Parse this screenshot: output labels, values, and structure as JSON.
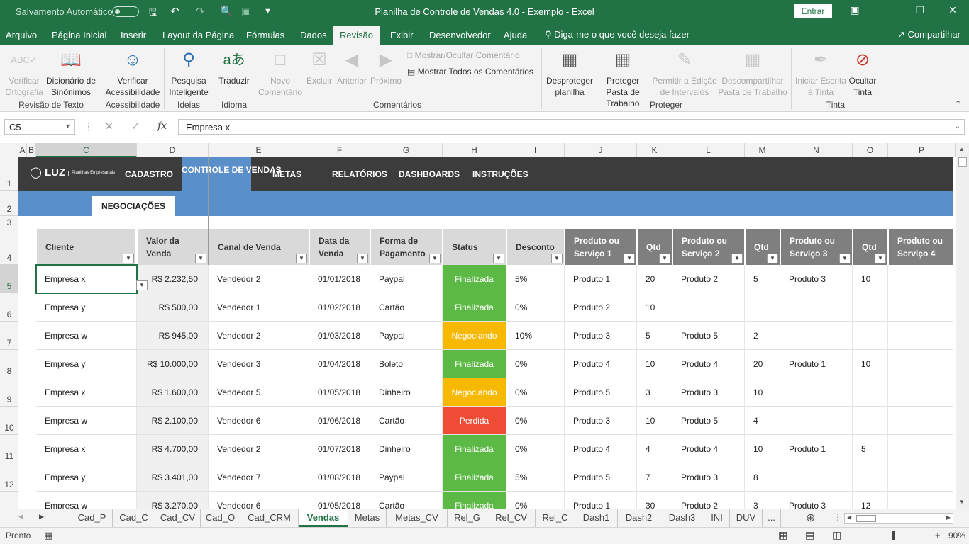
{
  "titlebar": {
    "autosave_label": "Salvamento Automático",
    "title": "Planilha de Controle de Vendas 4.0 - Exemplo  -  Excel",
    "signin": "Entrar"
  },
  "menu": {
    "tabs": [
      "Arquivo",
      "Página Inicial",
      "Inserir",
      "Layout da Página",
      "Fórmulas",
      "Dados",
      "Revisão",
      "Exibir",
      "Desenvolvedor",
      "Ajuda"
    ],
    "active_tab": "Revisão",
    "tell_me": "Diga-me o que você deseja fazer",
    "share": "Compartilhar"
  },
  "ribbon": {
    "spell_check": "Verificar Ortografia",
    "thesaurus": "Dicionário de Sinônimos",
    "group_proofing": "Revisão de Texto",
    "check_accessibility": "Verificar Acessibilidade",
    "group_accessibility": "Acessibilidade",
    "smart_lookup": "Pesquisa Inteligente",
    "group_insights": "Ideias",
    "translate": "Traduzir",
    "group_language": "Idioma",
    "new_comment": "Novo Comentário",
    "delete_comment": "Excluir",
    "previous_comment": "Anterior",
    "next_comment": "Próximo",
    "show_hide_comment": "Mostrar/Ocultar Comentário",
    "show_all_comments": "Mostrar Todos os Comentários",
    "group_comments": "Comentários",
    "unprotect_sheet": "Desproteger planilha",
    "protect_workbook": "Proteger Pasta de Trabalho",
    "allow_edit_ranges": "Permitir a Edição de Intervalos",
    "unshare_workbook": "Descompartilhar Pasta de Trabalho",
    "group_protect": "Proteger",
    "start_inking": "Iniciar Escrita à Tinta",
    "hide_ink": "Ocultar Tinta",
    "group_ink": "Tinta"
  },
  "formula_bar": {
    "name_box": "C5",
    "content": "Empresa x"
  },
  "columns": [
    "A",
    "B",
    "C",
    "D",
    "E",
    "F",
    "G",
    "H",
    "I",
    "J",
    "K",
    "L",
    "M",
    "N",
    "O",
    "P"
  ],
  "rows": [
    "1",
    "2",
    "3",
    "4",
    "5",
    "6",
    "7",
    "8",
    "9",
    "10",
    "11",
    "12"
  ],
  "nav": {
    "logo": "LUZ",
    "logo_sub": "Planilhas Empresariais",
    "items": [
      "CADASTRO",
      "CONTROLE DE VENDAS",
      "METAS",
      "RELATÓRIOS",
      "DASHBOARDS",
      "INSTRUÇÕES"
    ],
    "subtab": "NEGOCIAÇÕES"
  },
  "table": {
    "headers": [
      "Cliente",
      "Valor da Venda",
      "Canal de Venda",
      "Data da Venda",
      "Forma de Pagamento",
      "Status",
      "Desconto",
      "Produto ou Serviço 1",
      "Qtd",
      "Produto ou Serviço 2",
      "Qtd",
      "Produto ou Serviço 3",
      "Qtd",
      "Produto ou Serviço 4"
    ],
    "rows": [
      [
        "Empresa x",
        "R$ 2.232,50",
        "Vendedor 2",
        "01/01/2018",
        "Paypal",
        "Finalizada",
        "5%",
        "Produto 1",
        "20",
        "Produto 2",
        "5",
        "Produto 3",
        "10",
        ""
      ],
      [
        "Empresa y",
        "R$ 500,00",
        "Vendedor 1",
        "01/02/2018",
        "Cartão",
        "Finalizada",
        "0%",
        "Produto 2",
        "10",
        "",
        "",
        "",
        "",
        ""
      ],
      [
        "Empresa w",
        "R$ 945,00",
        "Vendedor 2",
        "01/03/2018",
        "Paypal",
        "Negociando",
        "10%",
        "Produto 3",
        "5",
        "Produto 5",
        "2",
        "",
        "",
        ""
      ],
      [
        "Empresa y",
        "R$ 10.000,00",
        "Vendedor 3",
        "01/04/2018",
        "Boleto",
        "Finalizada",
        "0%",
        "Produto 4",
        "10",
        "Produto 4",
        "20",
        "Produto 1",
        "10",
        ""
      ],
      [
        "Empresa x",
        "R$ 1.600,00",
        "Vendedor 5",
        "01/05/2018",
        "Dinheiro",
        "Negociando",
        "0%",
        "Produto 5",
        "3",
        "Produto 3",
        "10",
        "",
        "",
        ""
      ],
      [
        "Empresa w",
        "R$ 2.100,00",
        "Vendedor 6",
        "01/06/2018",
        "Cartão",
        "Perdida",
        "0%",
        "Produto 3",
        "10",
        "Produto 5",
        "4",
        "",
        "",
        ""
      ],
      [
        "Empresa x",
        "R$ 4.700,00",
        "Vendedor 2",
        "01/07/2018",
        "Dinheiro",
        "Finalizada",
        "0%",
        "Produto 4",
        "4",
        "Produto 4",
        "10",
        "Produto 1",
        "5",
        ""
      ],
      [
        "Empresa y",
        "R$ 3.401,00",
        "Vendedor 7",
        "01/08/2018",
        "Paypal",
        "Finalizada",
        "5%",
        "Produto 5",
        "7",
        "Produto 3",
        "8",
        "",
        "",
        ""
      ],
      [
        "Empresa w",
        "R$ 3.270,00",
        "Vendedor 6",
        "01/05/2018",
        "Cartão",
        "Finalizada",
        "0%",
        "Produto 1",
        "30",
        "Produto 2",
        "3",
        "Produto 3",
        "12",
        ""
      ]
    ],
    "status_colors": {
      "Finalizada": "#5cb946",
      "Negociando": "#f7b900",
      "Perdida": "#ef4b35"
    }
  },
  "sheets": [
    "Cad_P",
    "Cad_C",
    "Cad_CV",
    "Cad_O",
    "Cad_CRM",
    "Vendas",
    "Metas",
    "Metas_CV",
    "Rel_G",
    "Rel_CV",
    "Rel_C",
    "Dash1",
    "Dash2",
    "Dash3",
    "INI",
    "DUV",
    "..."
  ],
  "active_sheet": "Vendas",
  "status": {
    "ready": "Pronto",
    "zoom": "90%"
  }
}
